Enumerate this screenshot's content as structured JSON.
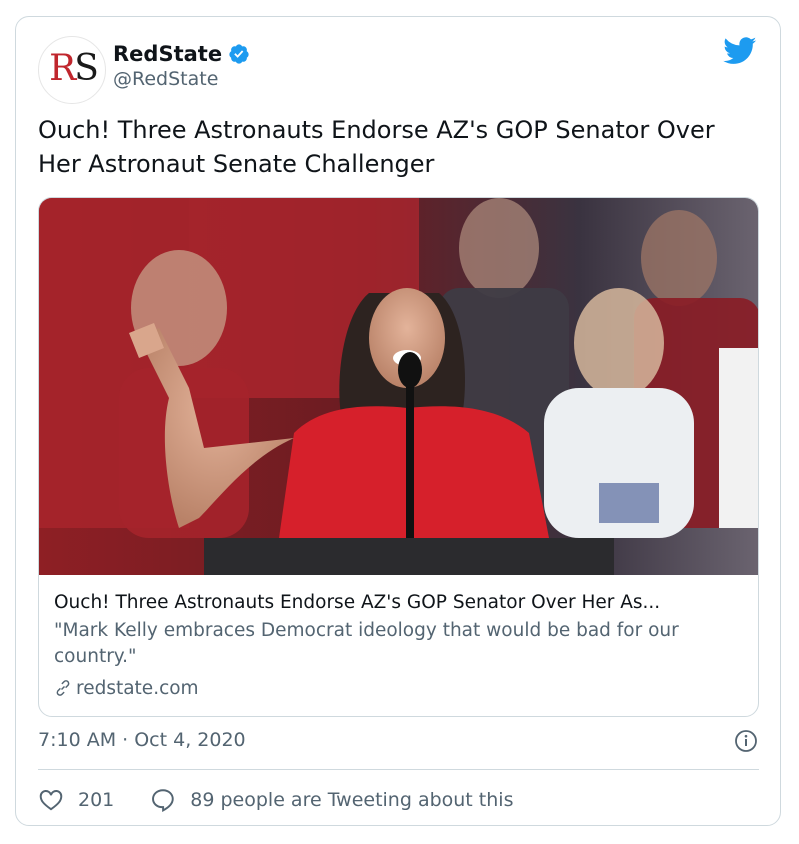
{
  "author": {
    "display_name": "RedState",
    "handle": "@RedState",
    "avatar_text_r": "R",
    "avatar_text_s": "S",
    "verified": true
  },
  "tweet": {
    "text": "Ouch! Three Astronauts Endorse AZ's GOP Senator Over Her Astronaut Senate Challenger",
    "timestamp": "7:10 AM · Oct 4, 2020"
  },
  "link_card": {
    "title": "Ouch! Three Astronauts Endorse AZ's GOP Senator Over Her As...",
    "description": "\"Mark Kelly embraces Democrat ideology that would be bad for our country.\"",
    "domain": "redstate.com"
  },
  "actions": {
    "likes": "201",
    "replies_text": "89 people are Tweeting about this"
  },
  "colors": {
    "twitter_blue": "#1d9bf0",
    "secondary_text": "#536471",
    "border": "#cfd9de",
    "brand_red": "#c0262d"
  },
  "icons": [
    "verified-badge-icon",
    "twitter-bird-icon",
    "link-icon",
    "info-icon",
    "heart-icon",
    "reply-icon"
  ]
}
